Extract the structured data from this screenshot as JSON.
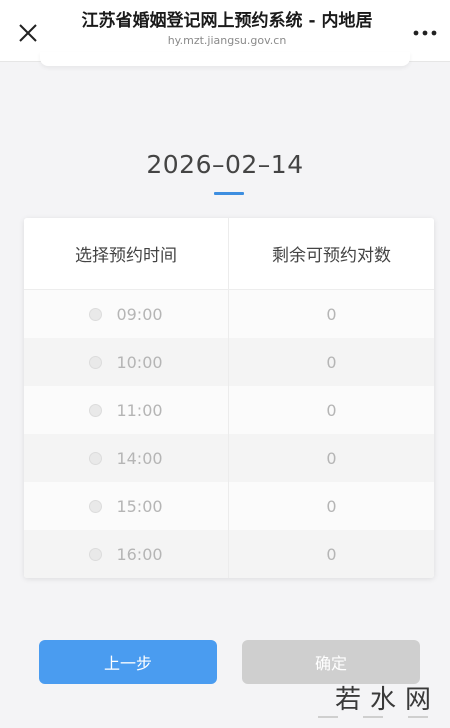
{
  "header": {
    "title": "江苏省婚姻登记网上预约系统 - 内地居",
    "url": "hy.mzt.jiangsu.gov.cn",
    "close_icon": "close-icon",
    "more_icon": "more-icon"
  },
  "date": "2026–02–14",
  "table": {
    "headers": [
      "选择预约时间",
      "剩余可预约对数"
    ],
    "rows": [
      {
        "time": "09:00",
        "remaining": "0"
      },
      {
        "time": "10:00",
        "remaining": "0"
      },
      {
        "time": "11:00",
        "remaining": "0"
      },
      {
        "time": "14:00",
        "remaining": "0"
      },
      {
        "time": "15:00",
        "remaining": "0"
      },
      {
        "time": "16:00",
        "remaining": "0"
      }
    ]
  },
  "buttons": {
    "prev": "上一步",
    "confirm": "确定"
  },
  "watermark": "若水网",
  "colors": {
    "accent": "#3d8ee0",
    "primary_button": "#4a9cf0",
    "disabled_button": "#cfcfcf"
  }
}
